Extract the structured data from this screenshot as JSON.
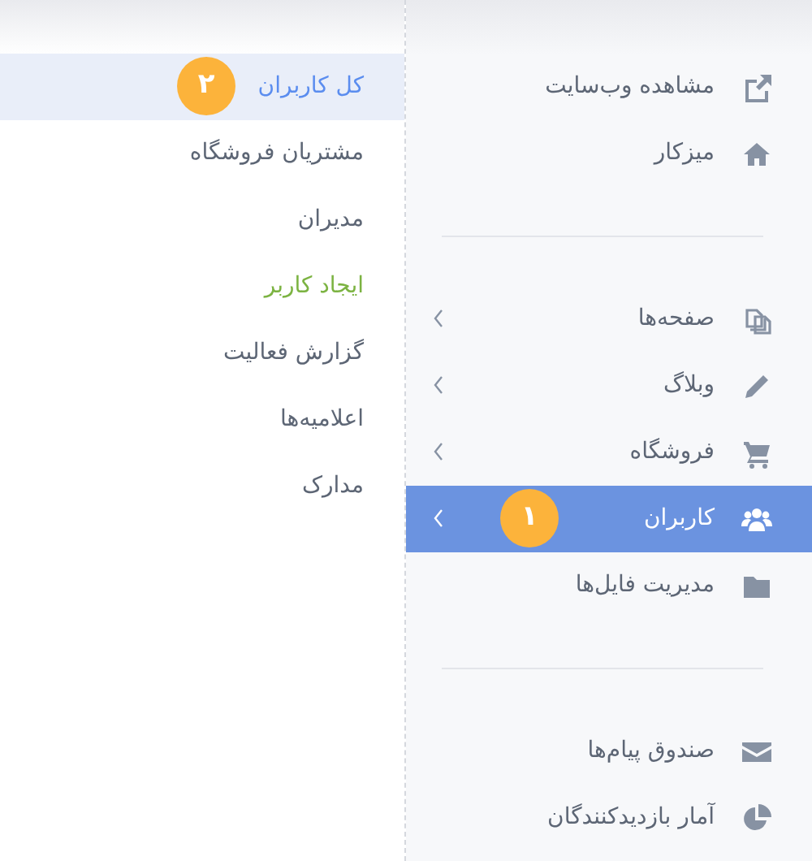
{
  "submenu": {
    "items": [
      {
        "label": "کل کاربران",
        "selected": true,
        "badge": "۲"
      },
      {
        "label": "مشتریان فروشگاه",
        "selected": false
      },
      {
        "label": "مدیران",
        "selected": false
      },
      {
        "label": "ایجاد کاربر",
        "selected": false,
        "color": "#7cb342"
      },
      {
        "label": "گزارش فعالیت",
        "selected": false
      },
      {
        "label": "اعلامیه‌ها",
        "selected": false
      },
      {
        "label": "مدارک",
        "selected": false
      }
    ]
  },
  "sidebar": {
    "groups": [
      {
        "items": [
          {
            "kind": "external",
            "label": "مشاهده وب‌سایت",
            "selected": false,
            "has_children": false
          },
          {
            "kind": "home",
            "label": "میزکار",
            "selected": false,
            "has_children": false
          }
        ]
      },
      {
        "items": [
          {
            "kind": "pages",
            "label": "صفحه‌ها",
            "selected": false,
            "has_children": true
          },
          {
            "kind": "pencil",
            "label": "وبلاگ",
            "selected": false,
            "has_children": true
          },
          {
            "kind": "cart",
            "label": "فروشگاه",
            "selected": false,
            "has_children": true
          },
          {
            "kind": "users",
            "label": "کاربران",
            "selected": true,
            "has_children": true,
            "badge": "۱"
          },
          {
            "kind": "folder",
            "label": "مدیریت فایل‌ها",
            "selected": false,
            "has_children": false
          }
        ]
      },
      {
        "items": [
          {
            "kind": "envelope",
            "label": "صندوق پیام‌ها",
            "selected": false,
            "has_children": false
          },
          {
            "kind": "pie",
            "label": "آمار بازدیدکنندگان",
            "selected": false,
            "has_children": false
          }
        ]
      }
    ]
  }
}
